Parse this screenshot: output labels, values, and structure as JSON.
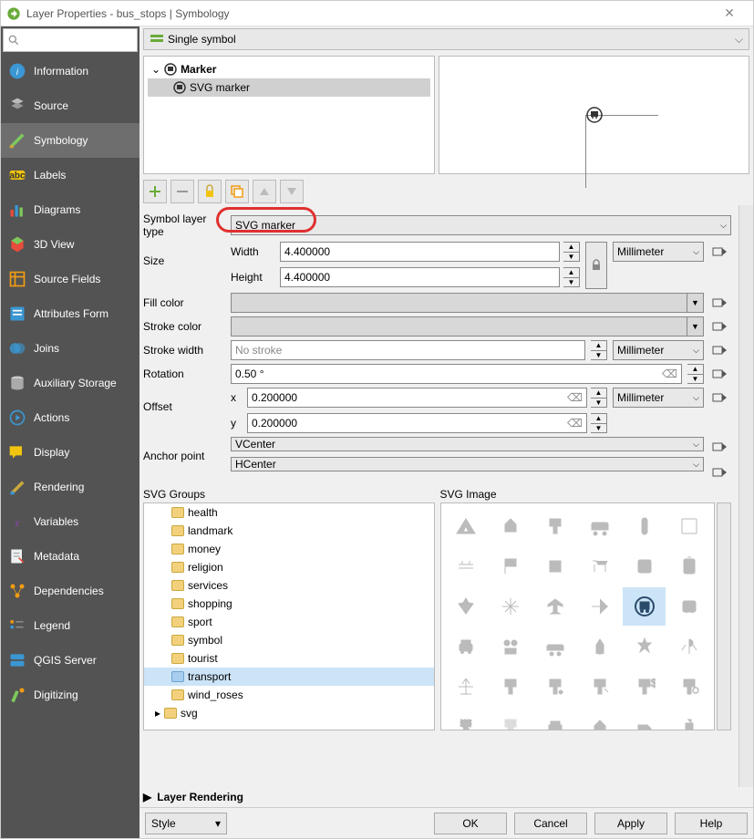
{
  "window": {
    "title": "Layer Properties - bus_stops | Symbology"
  },
  "sidebar": {
    "items": [
      "Information",
      "Source",
      "Symbology",
      "Labels",
      "Diagrams",
      "3D View",
      "Source Fields",
      "Attributes Form",
      "Joins",
      "Auxiliary Storage",
      "Actions",
      "Display",
      "Rendering",
      "Variables",
      "Metadata",
      "Dependencies",
      "Legend",
      "QGIS Server",
      "Digitizing"
    ]
  },
  "dropdown": {
    "renderer": "Single symbol"
  },
  "tree": {
    "root": "Marker",
    "child": "SVG marker"
  },
  "layerTypeLabel": "Symbol layer type",
  "layerType": "SVG marker",
  "size": {
    "label": "Size",
    "widthLabel": "Width",
    "width": "4.400000",
    "heightLabel": "Height",
    "height": "4.400000",
    "unit": "Millimeter"
  },
  "fill": {
    "label": "Fill color"
  },
  "stroke": {
    "label": "Stroke color"
  },
  "strokeWidth": {
    "label": "Stroke width",
    "value": "No stroke",
    "unit": "Millimeter"
  },
  "rotation": {
    "label": "Rotation",
    "value": "0.50 °"
  },
  "offset": {
    "label": "Offset",
    "xLabel": "x",
    "x": "0.200000",
    "yLabel": "y",
    "y": "0.200000",
    "unit": "Millimeter"
  },
  "anchor": {
    "label": "Anchor point",
    "v": "VCenter",
    "h": "HCenter"
  },
  "svgGroups": {
    "label": "SVG Groups",
    "folders": [
      "health",
      "landmark",
      "money",
      "religion",
      "services",
      "shopping",
      "sport",
      "symbol",
      "tourist",
      "transport",
      "wind_roses"
    ],
    "selected": "transport",
    "root": "svg"
  },
  "svgImage": {
    "label": "SVG Image"
  },
  "layerRendering": "Layer Rendering",
  "bottom": {
    "style": "Style",
    "ok": "OK",
    "cancel": "Cancel",
    "apply": "Apply",
    "help": "Help"
  }
}
